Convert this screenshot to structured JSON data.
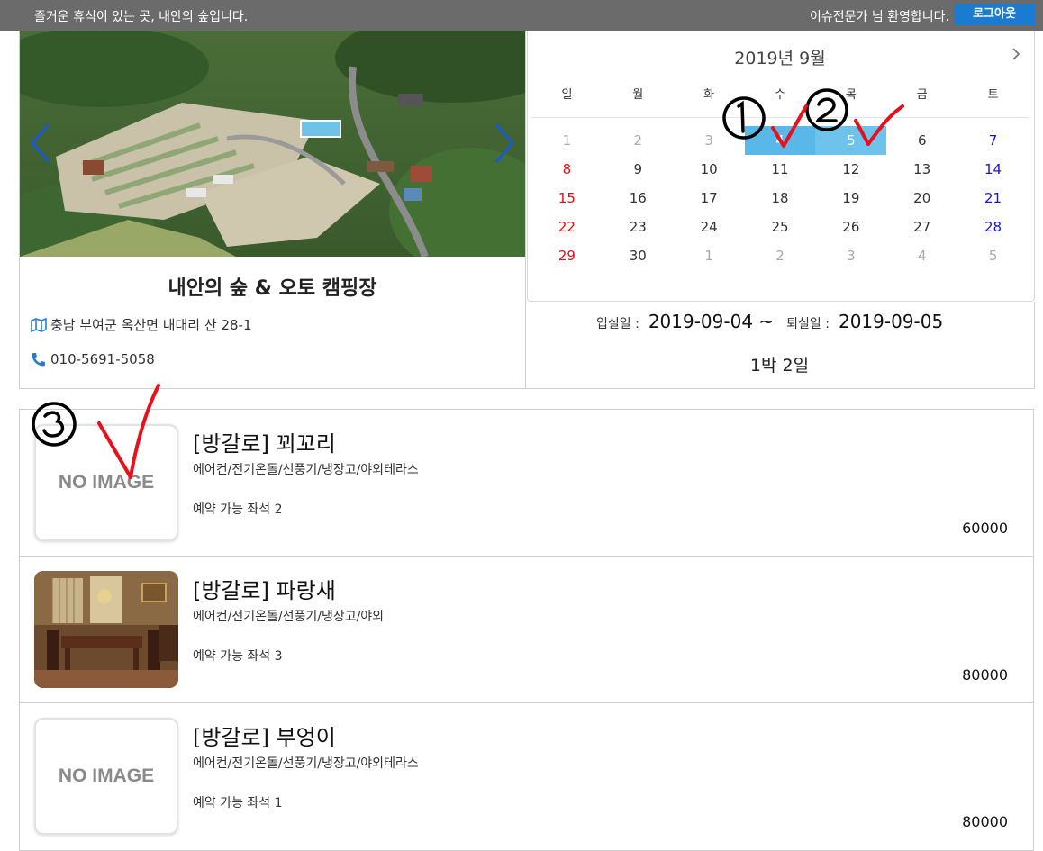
{
  "topbar": {
    "tagline": "즐거운 휴식이 있는 곳, 내안의 숲입니다.",
    "welcome": "이슈전문가 님 환영합니다.",
    "logout_label": "로그아웃"
  },
  "camp": {
    "name": "내안의 숲 & 오토 캠핑장",
    "address": "충남 부여군 옥산면 내대리 산 28-1",
    "phone": "010-5691-5058",
    "icons": {
      "address": "map-icon",
      "phone": "phone-icon"
    }
  },
  "calendar": {
    "title": "2019년  9월",
    "weekdays": [
      "일",
      "월",
      "화",
      "수",
      "목",
      "금",
      "토"
    ],
    "days": [
      [
        "1",
        "2",
        "3",
        "4",
        "5",
        "6",
        "7"
      ],
      [
        "8",
        "9",
        "10",
        "11",
        "12",
        "13",
        "14"
      ],
      [
        "15",
        "16",
        "17",
        "18",
        "19",
        "20",
        "21"
      ],
      [
        "22",
        "23",
        "24",
        "25",
        "26",
        "27",
        "28"
      ],
      [
        "29",
        "30",
        "1",
        "2",
        "3",
        "4",
        "5"
      ]
    ],
    "selected": [
      "4",
      "5"
    ]
  },
  "booking": {
    "checkin_label": "입실일 :",
    "checkin_value": "2019-09-04 ~",
    "checkout_label": "퇴실일 :",
    "checkout_value": "2019-09-05",
    "nights": "1박 2일"
  },
  "rooms": [
    {
      "name": "[방갈로] 꾀꼬리",
      "features": "에어컨/전기온돌/선풍기/냉장고/야외테라스",
      "seats": "예약 가능 좌석 2",
      "price": "60000",
      "image": "NO IMAGE"
    },
    {
      "name": "[방갈로] 파랑새",
      "features": "에어컨/전기온돌/선풍기/냉장고/야외",
      "seats": "예약 가능 좌석 3",
      "price": "80000",
      "image": ""
    },
    {
      "name": "[방갈로] 부엉이",
      "features": "에어컨/전기온돌/선풍기/냉장고/야외테라스",
      "seats": "예약 가능 좌석 1",
      "price": "80000",
      "image": "NO IMAGE"
    }
  ],
  "colors": {
    "topbar": "#6b6b6b",
    "logout": "#1a7bd0",
    "selected_day": "#5ab8e8",
    "sunday": "#e01010",
    "saturday": "#1515d8",
    "annotation": "#e8101a"
  }
}
